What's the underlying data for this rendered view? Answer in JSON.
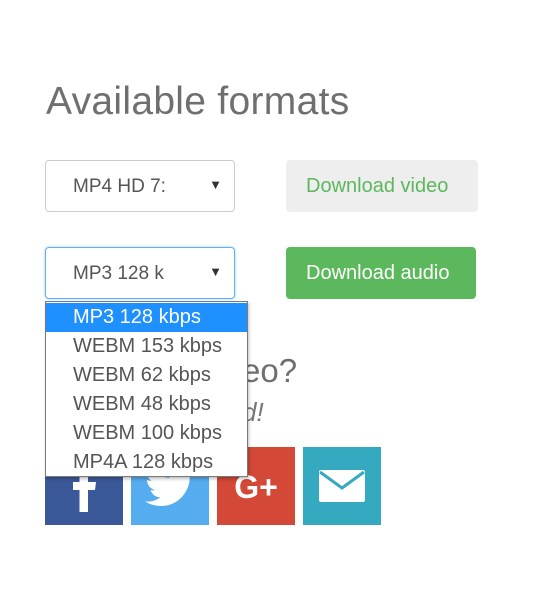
{
  "page": {
    "title": "Available formats"
  },
  "video_select": {
    "value": "MP4 HD 7:",
    "arrow_icon": "triangle-down-icon"
  },
  "audio_select": {
    "value": "MP3 128 k",
    "arrow_icon": "triangle-down-icon",
    "options": [
      "MP3 128 kbps",
      "WEBM 153 kbps",
      "WEBM 62 kbps",
      "WEBM 48 kbps",
      "WEBM 100 kbps",
      "MP4A 128 kbps"
    ],
    "highlighted_option": "MP3 128 kbps"
  },
  "buttons": {
    "download_video": "Download video",
    "download_audio": "Download audio"
  },
  "share": {
    "heading": "eo?",
    "subheading": "d!",
    "items": [
      {
        "name": "facebook",
        "icon": "facebook-icon",
        "color": "#3b5998"
      },
      {
        "name": "twitter",
        "icon": "twitter-icon",
        "color": "#55acee"
      },
      {
        "name": "google-plus",
        "icon": "google-plus-icon",
        "label": "G+",
        "color": "#d34836"
      },
      {
        "name": "email",
        "icon": "envelope-icon",
        "color": "#35a9bf"
      }
    ]
  },
  "colors": {
    "success_green": "#5cb85c",
    "highlight_blue": "#1e90ff",
    "title_gray": "#6f6f6f"
  }
}
